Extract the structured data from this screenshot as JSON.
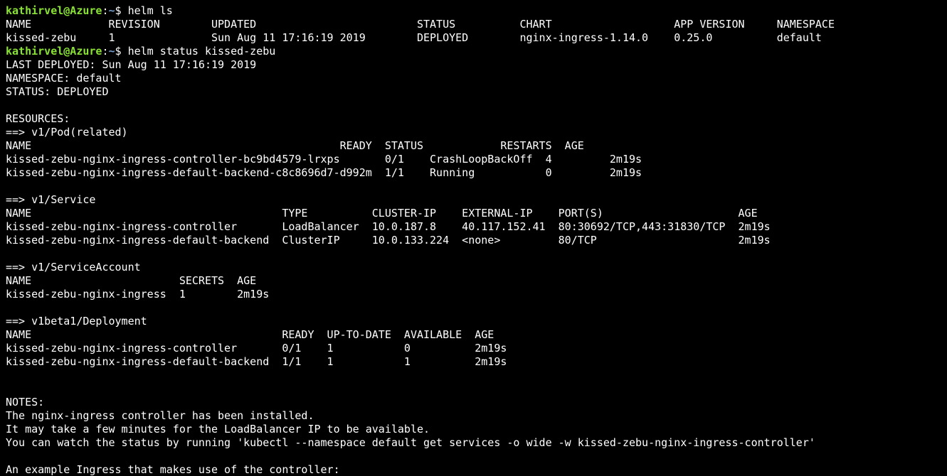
{
  "colors": {
    "background": "#000000",
    "text": "#ffffff",
    "prompt_user": "#8ae234",
    "prompt_path": "#729fcf"
  },
  "prompt": {
    "user_host": "kathirvel@Azure",
    "separator": ":",
    "path": "~",
    "symbol": "$ "
  },
  "commands": {
    "first": "helm ls",
    "second": "helm status kissed-zebu"
  },
  "helm_ls": {
    "header": "NAME            REVISION        UPDATED                         STATUS          CHART                   APP VERSION     NAMESPACE",
    "rows": [
      "kissed-zebu     1               Sun Aug 11 17:16:19 2019        DEPLOYED        nginx-ingress-1.14.0    0.25.0          default"
    ]
  },
  "status_lines": [
    "LAST DEPLOYED: Sun Aug 11 17:16:19 2019",
    "NAMESPACE: default",
    "STATUS: DEPLOYED",
    "",
    "RESOURCES:",
    "==> v1/Pod(related)",
    "NAME                                                READY  STATUS            RESTARTS  AGE",
    "kissed-zebu-nginx-ingress-controller-bc9bd4579-lrxps       0/1    CrashLoopBackOff  4         2m19s",
    "kissed-zebu-nginx-ingress-default-backend-c8c8696d7-d992m  1/1    Running           0         2m19s",
    "",
    "==> v1/Service",
    "NAME                                       TYPE          CLUSTER-IP    EXTERNAL-IP    PORT(S)                     AGE",
    "kissed-zebu-nginx-ingress-controller       LoadBalancer  10.0.187.8    40.117.152.41  80:30692/TCP,443:31830/TCP  2m19s",
    "kissed-zebu-nginx-ingress-default-backend  ClusterIP     10.0.133.224  <none>         80/TCP                      2m19s",
    "",
    "==> v1/ServiceAccount",
    "NAME                       SECRETS  AGE",
    "kissed-zebu-nginx-ingress  1        2m19s",
    "",
    "==> v1beta1/Deployment",
    "NAME                                       READY  UP-TO-DATE  AVAILABLE  AGE",
    "kissed-zebu-nginx-ingress-controller       0/1    1           0          2m19s",
    "kissed-zebu-nginx-ingress-default-backend  1/1    1           1          2m19s",
    "",
    "",
    "NOTES:",
    "The nginx-ingress controller has been installed.",
    "It may take a few minutes for the LoadBalancer IP to be available.",
    "You can watch the status by running 'kubectl --namespace default get services -o wide -w kissed-zebu-nginx-ingress-controller'",
    "",
    "An example Ingress that makes use of the controller:"
  ]
}
